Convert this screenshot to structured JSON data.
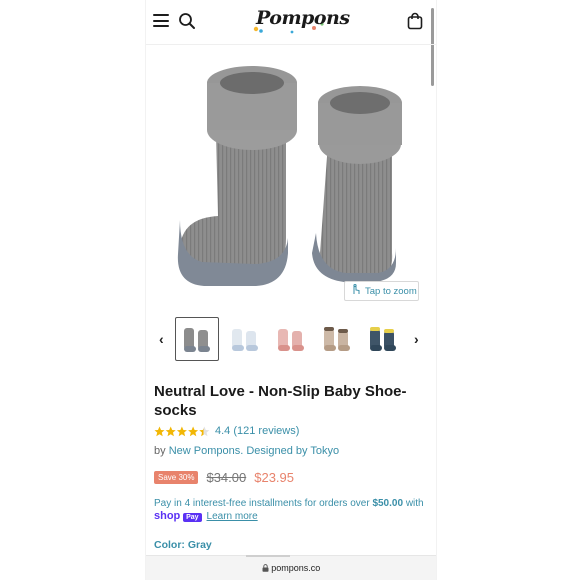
{
  "header": {
    "logo_text": "Pompons",
    "menu_icon": "hamburger-icon",
    "search_icon": "search-icon",
    "cart_icon": "shopping-bag-icon"
  },
  "gallery": {
    "zoom_label": "Tap to zoom",
    "thumbnail_colors": [
      "gray",
      "light blue",
      "pink",
      "beige",
      "navy/yellow"
    ],
    "selected_thumbnail": 0
  },
  "product": {
    "title": "Neutral Love - Non-Slip Baby Shoe-socks",
    "rating_value": 4.4,
    "rating_text": "4.4 (121 reviews)",
    "vendor_prefix": "by",
    "vendor_name": "New Pompons. Designed by Tokyo",
    "save_badge": "Save 30%",
    "old_price": "$34.00",
    "new_price": "$23.95",
    "installments_text": "Pay in 4 interest-free installments for orders over",
    "installments_amount": "$50.00",
    "installments_suffix": "with",
    "shop_word": "shop",
    "pay_word": "Pay",
    "learn_more": "Learn more",
    "color_label": "Color: Gray"
  },
  "browser": {
    "url": "pompons.co"
  },
  "colors": {
    "accent": "#3a8fa8",
    "sale": "#e8836c",
    "shop_pay": "#5a31f4",
    "star": "#f2b705"
  }
}
